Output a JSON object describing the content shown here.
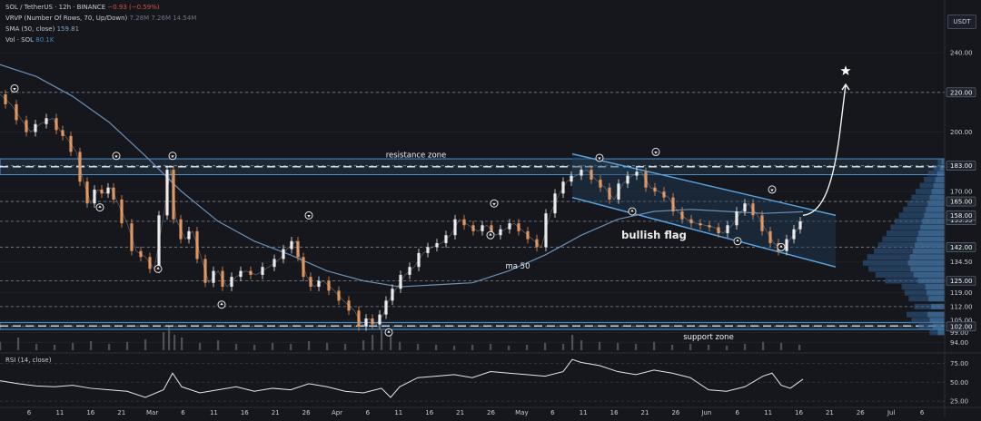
{
  "header": {
    "symbol": "SOL / TetherUS · 12h · BINANCE",
    "change": "−0.93 (−0.59%)",
    "vrvp_label": "VRVP (Number Of Rows, 70, Up/Down)",
    "vrvp_values": "7.28M  7.26M  14.54M",
    "sma_label": "SMA (50, close)",
    "sma_value": "159.81",
    "vol_label": "Vol · SOL",
    "vol_value": "80.1K",
    "currency": "USDT"
  },
  "colors": {
    "background": "#15171d",
    "up": "#ececec",
    "down": "#e0935a",
    "ma": "#6d8fb5",
    "zone": "#5aa7e6",
    "flag_fill": "#1f3b56",
    "profile": "#2f5d8c",
    "rsi_line": "#e6e6e6"
  },
  "chart_data": [
    {
      "type": "line",
      "title": "SOL / TetherUS · 12h",
      "y_axis": {
        "ticks": [
          94.0,
          99.0,
          105.0,
          112.0,
          119.0,
          125.0,
          134.5,
          142.0,
          155.0,
          165.0,
          170.0,
          183.0,
          200.0,
          220.0,
          240.0
        ],
        "highlighted_labels": [
          "102.00",
          "125.00",
          "142.00",
          "155.55",
          "158.00",
          "165.00",
          "183.00",
          "220.00"
        ],
        "range": [
          90,
          262
        ]
      },
      "x_axis": {
        "ticks": [
          "6",
          "11",
          "16",
          "21",
          "Mar",
          "6",
          "11",
          "16",
          "21",
          "26",
          "Apr",
          "6",
          "11",
          "16",
          "21",
          "26",
          "May",
          "6",
          "11",
          "16",
          "21",
          "26",
          "Jun",
          "6",
          "11",
          "16",
          "21",
          "26",
          "Jul",
          "6"
        ]
      },
      "series": [
        {
          "name": "SOL",
          "x": [
            0,
            12,
            24,
            34,
            44,
            58,
            66,
            72,
            84,
            92,
            100,
            108,
            116,
            122,
            128,
            140,
            150,
            160,
            170,
            180,
            188,
            194,
            204,
            212,
            222,
            230,
            240,
            250,
            260,
            270,
            282,
            296,
            308,
            316,
            326,
            330,
            338,
            346,
            356,
            368,
            378,
            390,
            400,
            406,
            414,
            422,
            428,
            436,
            446,
            456,
            466,
            476,
            486,
            496,
            506,
            516,
            526,
            536,
            546,
            556,
            566,
            576,
            586,
            596,
            606,
            616,
            624,
            634,
            646,
            656,
            666,
            676,
            686,
            696,
            706,
            716,
            726,
            736,
            746,
            756,
            766,
            776,
            786,
            796,
            806,
            816,
            824,
            834,
            844,
            852,
            862,
            870,
            878,
            884
          ],
          "y": [
            219,
            214,
            206,
            200,
            204,
            207,
            201,
            198,
            190,
            175,
            164,
            171,
            169,
            172,
            166,
            154,
            140,
            137,
            131,
            158,
            181,
            156,
            146,
            150,
            136,
            124,
            130,
            122,
            127,
            130,
            128,
            132,
            136,
            141,
            145,
            137,
            127,
            122,
            125,
            120,
            115,
            110,
            102,
            106,
            103,
            108,
            115,
            121,
            128,
            132,
            139,
            142,
            144,
            148,
            156,
            153,
            150,
            153,
            148,
            151,
            154,
            150,
            146,
            142,
            159,
            169,
            175,
            178,
            181,
            176,
            172,
            166,
            174,
            178,
            180,
            172,
            170,
            167,
            160,
            156,
            154,
            153,
            152,
            149,
            153,
            160,
            164,
            158,
            150,
            144,
            140,
            146,
            151,
            155
          ]
        },
        {
          "name": "ma 50",
          "x": [
            0,
            40,
            80,
            120,
            160,
            200,
            240,
            280,
            320,
            360,
            400,
            440,
            480,
            520,
            560,
            600,
            640,
            680,
            720,
            760,
            800,
            840,
            884
          ],
          "y": [
            234,
            228,
            218,
            205,
            188,
            170,
            155,
            145,
            138,
            130,
            125,
            122,
            123,
            124,
            130,
            138,
            148,
            156,
            160,
            161,
            160,
            159,
            159.81
          ]
        }
      ],
      "annotations": [
        {
          "text": "resistance zone",
          "y": 183
        },
        {
          "text": "support zone",
          "y": 102
        },
        {
          "text": "bullish flag",
          "x": 720,
          "y": 148
        },
        {
          "text": "ma 50",
          "x": 570,
          "y": 133
        }
      ],
      "zones": [
        {
          "name": "resistance zone",
          "from": 178.5,
          "to": 186.5
        },
        {
          "name": "support zone",
          "from": 100.5,
          "to": 104
        }
      ],
      "horizontal_levels": [
        220,
        183,
        165,
        155,
        142,
        125,
        112,
        102
      ],
      "bullish_flag": {
        "top": [
          [
            630,
            189
          ],
          [
            920,
            158
          ]
        ],
        "bottom": [
          [
            630,
            167
          ],
          [
            920,
            132
          ]
        ]
      },
      "projection": [
        [
          884,
          158
        ],
        [
          905,
          159
        ],
        [
          918,
          172
        ],
        [
          926,
          205
        ],
        [
          931,
          224
        ]
      ],
      "target": {
        "x": 931,
        "y": 229
      },
      "swing_highs": [
        [
          16,
          222
        ],
        [
          128,
          188
        ],
        [
          190,
          188
        ],
        [
          340,
          158
        ],
        [
          544,
          164
        ],
        [
          660,
          187
        ],
        [
          722,
          190
        ],
        [
          850,
          171
        ]
      ],
      "swing_lows": [
        [
          110,
          162
        ],
        [
          174,
          131
        ],
        [
          244,
          113
        ],
        [
          428,
          99
        ],
        [
          540,
          148
        ],
        [
          696,
          160
        ],
        [
          812,
          145
        ],
        [
          860,
          142
        ]
      ],
      "volume": {
        "x": [
          0,
          20,
          40,
          60,
          80,
          100,
          120,
          140,
          160,
          180,
          186,
          192,
          200,
          220,
          240,
          260,
          280,
          300,
          320,
          340,
          360,
          380,
          400,
          410,
          420,
          430,
          440,
          460,
          480,
          500,
          520,
          540,
          560,
          580,
          600,
          620,
          630,
          640,
          660,
          680,
          700,
          720,
          740,
          760,
          780,
          800,
          820,
          840,
          860,
          880
        ],
        "y": [
          9,
          14,
          7,
          6,
          8,
          10,
          7,
          9,
          12,
          20,
          26,
          17,
          14,
          8,
          11,
          7,
          6,
          8,
          7,
          10,
          8,
          7,
          11,
          17,
          23,
          18,
          9,
          7,
          6,
          5,
          6,
          7,
          5,
          6,
          8,
          7,
          17,
          11,
          9,
          8,
          7,
          9,
          6,
          7,
          6,
          5,
          7,
          9,
          8,
          6
        ]
      },
      "volume_profile": {
        "price": [
          99,
          102,
          105,
          108,
          112,
          116,
          119,
          122,
          125,
          128,
          131,
          134,
          137,
          140,
          143,
          146,
          149,
          152,
          155,
          158,
          161,
          164,
          167,
          170,
          173,
          176,
          179,
          182,
          185
        ],
        "volume": [
          22,
          38,
          48,
          55,
          44,
          52,
          58,
          62,
          86,
          100,
          110,
          118,
          112,
          102,
          96,
          90,
          84,
          78,
          72,
          66,
          60,
          54,
          48,
          42,
          36,
          30,
          24,
          16,
          10
        ]
      }
    },
    {
      "type": "line",
      "title": "RSI (14, close)",
      "y_axis": {
        "ticks": [
          25.0,
          50.0,
          75.0
        ],
        "range": [
          18,
          85
        ]
      },
      "series": [
        {
          "name": "RSI",
          "x": [
            0,
            20,
            40,
            60,
            80,
            100,
            120,
            140,
            160,
            180,
            190,
            200,
            220,
            240,
            260,
            280,
            300,
            320,
            340,
            360,
            380,
            400,
            420,
            430,
            440,
            460,
            480,
            500,
            520,
            540,
            560,
            580,
            600,
            620,
            630,
            640,
            660,
            680,
            700,
            720,
            740,
            760,
            780,
            800,
            820,
            840,
            850,
            860,
            870,
            884
          ],
          "y": [
            52,
            48,
            45,
            44,
            46,
            42,
            40,
            38,
            30,
            40,
            62,
            44,
            36,
            40,
            44,
            38,
            42,
            40,
            48,
            44,
            38,
            36,
            42,
            30,
            44,
            56,
            58,
            60,
            56,
            64,
            62,
            60,
            58,
            64,
            80,
            76,
            72,
            64,
            60,
            66,
            62,
            56,
            40,
            38,
            44,
            58,
            62,
            46,
            42,
            54
          ]
        }
      ]
    }
  ]
}
